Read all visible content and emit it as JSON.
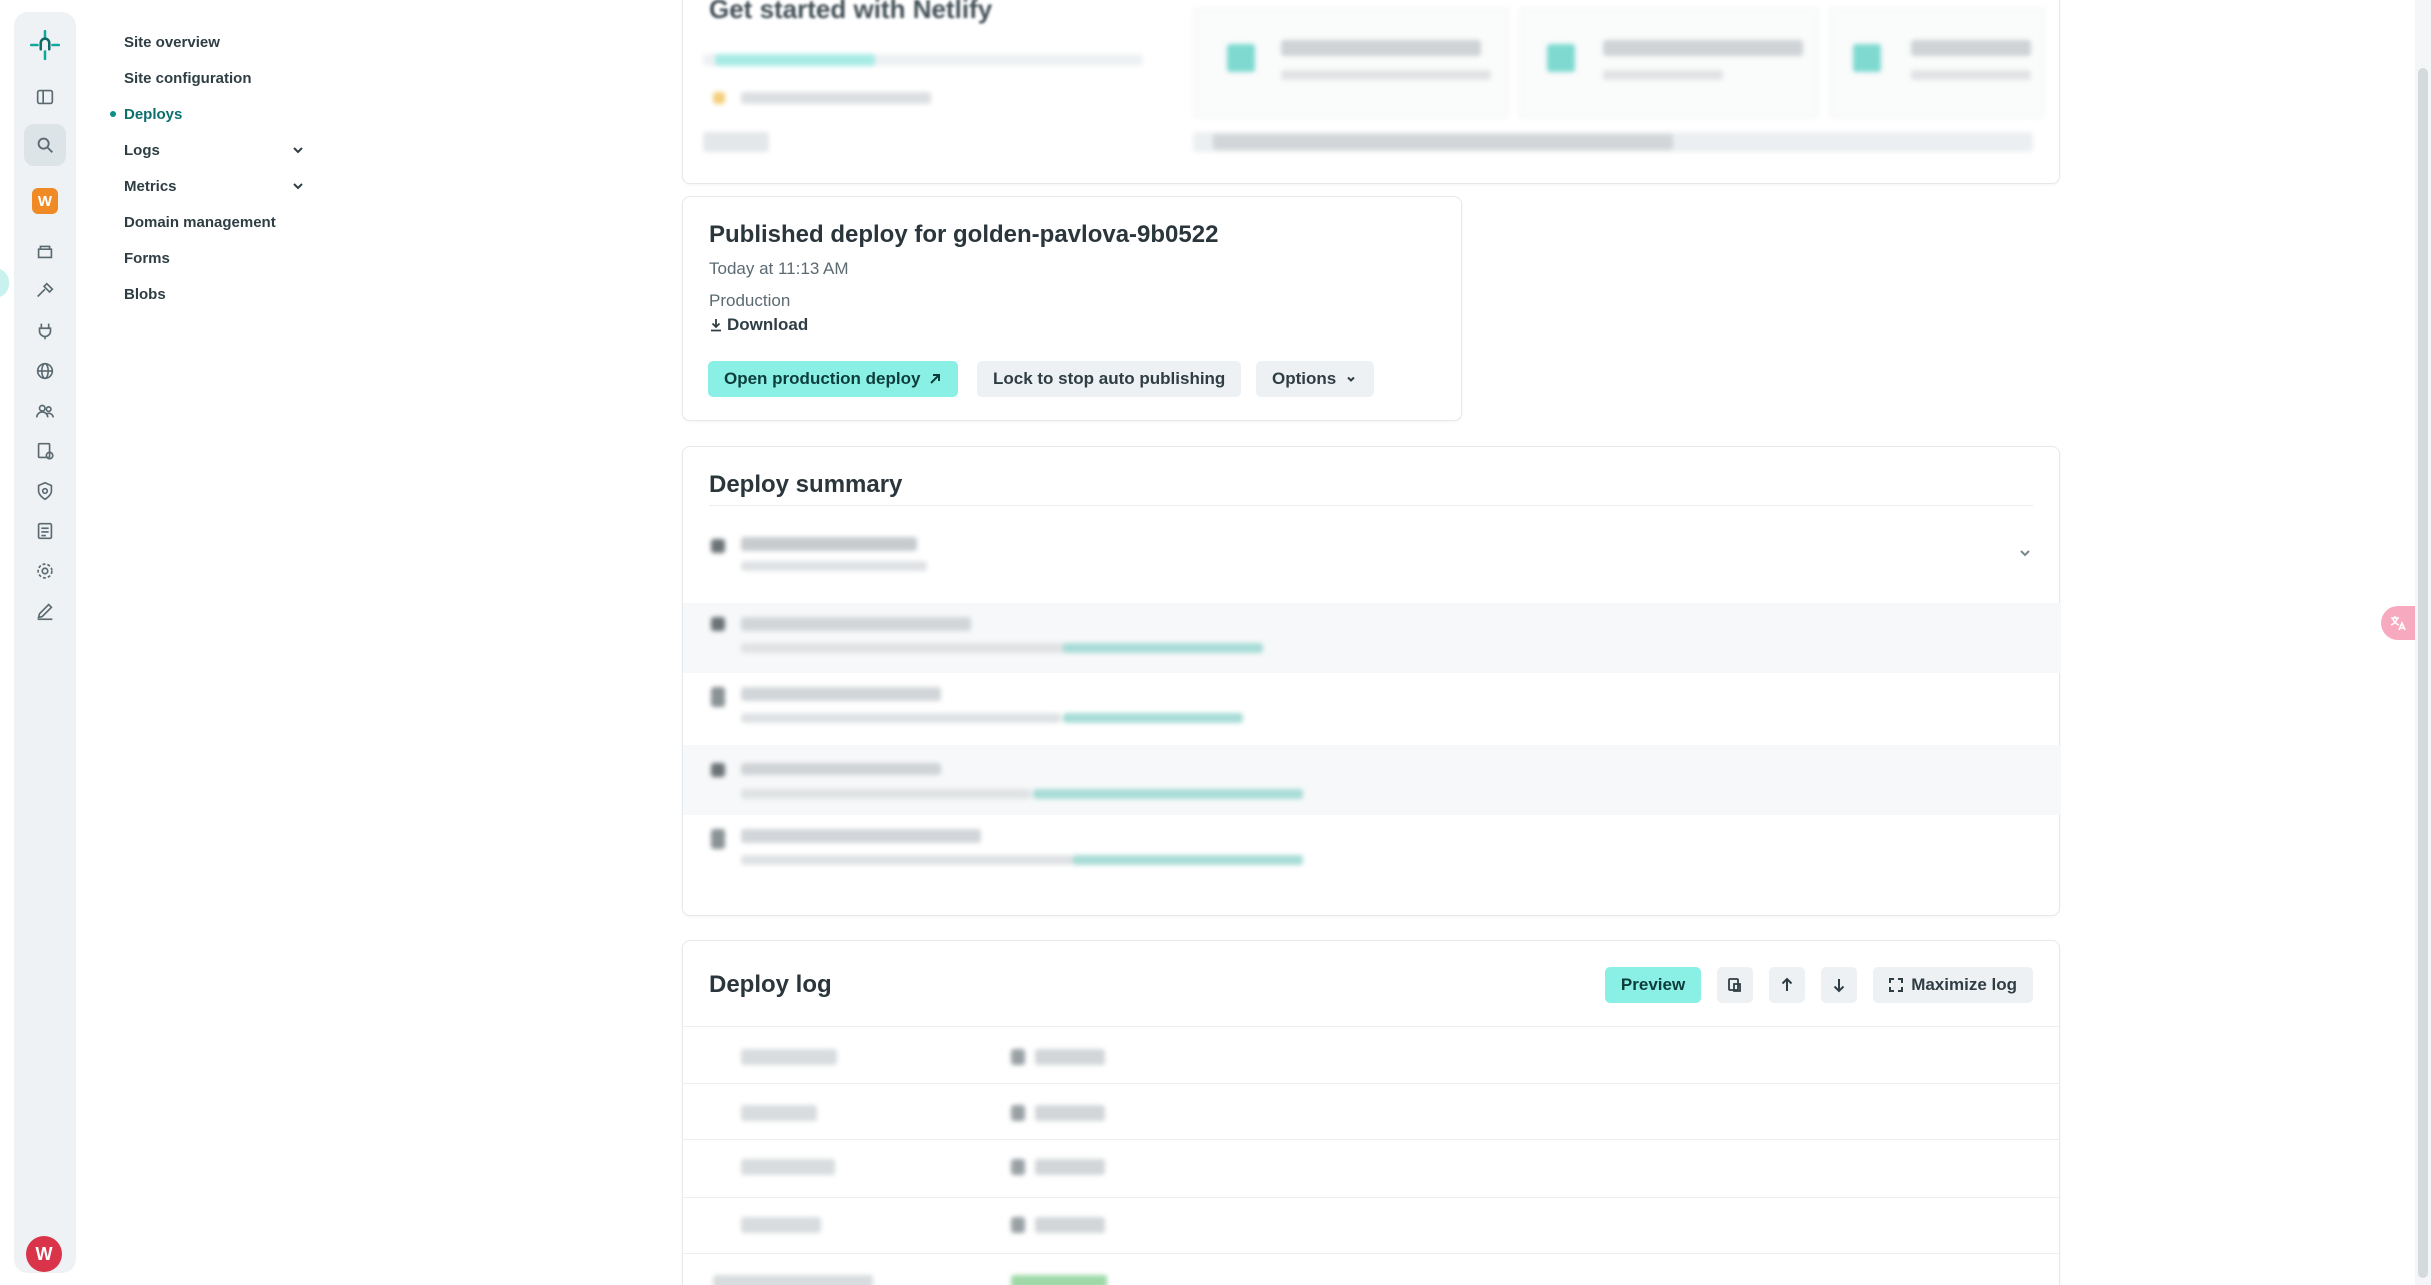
{
  "rail": {
    "logo_icon": "netlify-logo-icon",
    "team_badge": "W",
    "user_avatar": "W",
    "icons": [
      "sidebar-toggle-icon",
      "search-icon",
      "team-badge",
      "projects-icon",
      "builds-icon",
      "integrations-icon",
      "globe-icon",
      "members-icon",
      "billing-icon",
      "security-icon",
      "docs-icon",
      "settings-icon",
      "edit-icon"
    ]
  },
  "site_nav": {
    "items": [
      {
        "label": "Site overview",
        "active": false,
        "expandable": false
      },
      {
        "label": "Site configuration",
        "active": false,
        "expandable": false
      },
      {
        "label": "Deploys",
        "active": true,
        "expandable": false
      },
      {
        "label": "Logs",
        "active": false,
        "expandable": true
      },
      {
        "label": "Metrics",
        "active": false,
        "expandable": true
      },
      {
        "label": "Domain management",
        "active": false,
        "expandable": false
      },
      {
        "label": "Forms",
        "active": false,
        "expandable": false
      },
      {
        "label": "Blobs",
        "active": false,
        "expandable": false
      }
    ]
  },
  "get_started": {
    "title": "Get started with Netlify"
  },
  "published": {
    "title": "Published deploy for golden-pavlova-9b0522",
    "time": "Today at 11:13 AM",
    "context": "Production",
    "download_label": "Download",
    "open_label": "Open production deploy",
    "lock_label": "Lock to stop auto publishing",
    "options_label": "Options"
  },
  "summary": {
    "title": "Deploy summary"
  },
  "log": {
    "title": "Deploy log",
    "preview_label": "Preview",
    "maximize_label": "Maximize log"
  },
  "colors": {
    "accent": "#8af0e6",
    "active_nav": "#0b6f6b",
    "team_badge": "#f08a24",
    "avatar": "#d9344a"
  }
}
